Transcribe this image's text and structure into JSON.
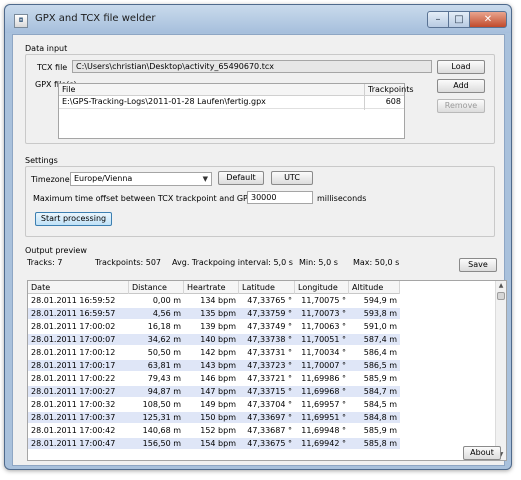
{
  "window": {
    "title": "GPX and TCX file welder",
    "icon_label": "◘",
    "min_glyph": "–",
    "max_glyph": "□",
    "close_glyph": "✕"
  },
  "data_input": {
    "section_title": "Data input",
    "tcx_label": "TCX file",
    "tcx_value": "C:\\Users\\christian\\Desktop\\activity_65490670.tcx",
    "gpx_label": "GPX file(s)",
    "load_button": "Load",
    "add_button": "Add",
    "remove_button": "Remove",
    "gpx_table": {
      "columns": [
        "File",
        "Trackpoints"
      ],
      "rows": [
        {
          "file": "E:\\GPS-Tracking-Logs\\2011-01-28 Laufen\\fertig.gpx",
          "trackpoints": "608"
        }
      ]
    }
  },
  "settings": {
    "section_title": "Settings",
    "timezone_label": "Timezone",
    "timezone_value": "Europe/Vienna",
    "default_button": "Default",
    "utc_button": "UTC",
    "offset_label": "Maximum time offset between TCX trackpoint and GPX waypoint",
    "offset_value": "30000",
    "offset_unit": "milliseconds",
    "start_button": "Start processing"
  },
  "output": {
    "section_title": "Output preview",
    "tracks": "Tracks:  7",
    "trackpoints": "Trackpoints:  507",
    "avg_interval": "Avg. Trackpoing interval:  5,0 s",
    "min": "Min:  5,0 s",
    "max": "Max:  50,0 s",
    "save_button": "Save",
    "columns": [
      "Date",
      "Distance",
      "Heartrate",
      "Latitude",
      "Longitude",
      "Altitude"
    ],
    "rows": [
      [
        "28.01.2011 16:59:52",
        "0,00 m",
        "134 bpm",
        "47,33765 °",
        "11,70075 °",
        "594,9 m"
      ],
      [
        "28.01.2011 16:59:57",
        "4,56 m",
        "135 bpm",
        "47,33759 °",
        "11,70073 °",
        "593,8 m"
      ],
      [
        "28.01.2011 17:00:02",
        "16,18 m",
        "139 bpm",
        "47,33749 °",
        "11,70063 °",
        "591,0 m"
      ],
      [
        "28.01.2011 17:00:07",
        "34,62 m",
        "140 bpm",
        "47,33738 °",
        "11,70051 °",
        "587,4 m"
      ],
      [
        "28.01.2011 17:00:12",
        "50,50 m",
        "142 bpm",
        "47,33731 °",
        "11,70034 °",
        "586,4 m"
      ],
      [
        "28.01.2011 17:00:17",
        "63,81 m",
        "143 bpm",
        "47,33723 °",
        "11,70007 °",
        "586,5 m"
      ],
      [
        "28.01.2011 17:00:22",
        "79,43 m",
        "146 bpm",
        "47,33721 °",
        "11,69986 °",
        "585,9 m"
      ],
      [
        "28.01.2011 17:00:27",
        "94,87 m",
        "147 bpm",
        "47,33715 °",
        "11,69968 °",
        "584,7 m"
      ],
      [
        "28.01.2011 17:00:32",
        "108,50 m",
        "149 bpm",
        "47,33704 °",
        "11,69957 °",
        "584,5 m"
      ],
      [
        "28.01.2011 17:00:37",
        "125,31 m",
        "150 bpm",
        "47,33697 °",
        "11,69951 °",
        "584,8 m"
      ],
      [
        "28.01.2011 17:00:42",
        "140,68 m",
        "152 bpm",
        "47,33687 °",
        "11,69948 °",
        "585,9 m"
      ],
      [
        "28.01.2011 17:00:47",
        "156,50 m",
        "154 bpm",
        "47,33675 °",
        "11,69942 °",
        "585,8 m"
      ]
    ]
  },
  "about_button": "About",
  "scroll": {
    "up_glyph": "▲",
    "down_glyph": "▼"
  }
}
